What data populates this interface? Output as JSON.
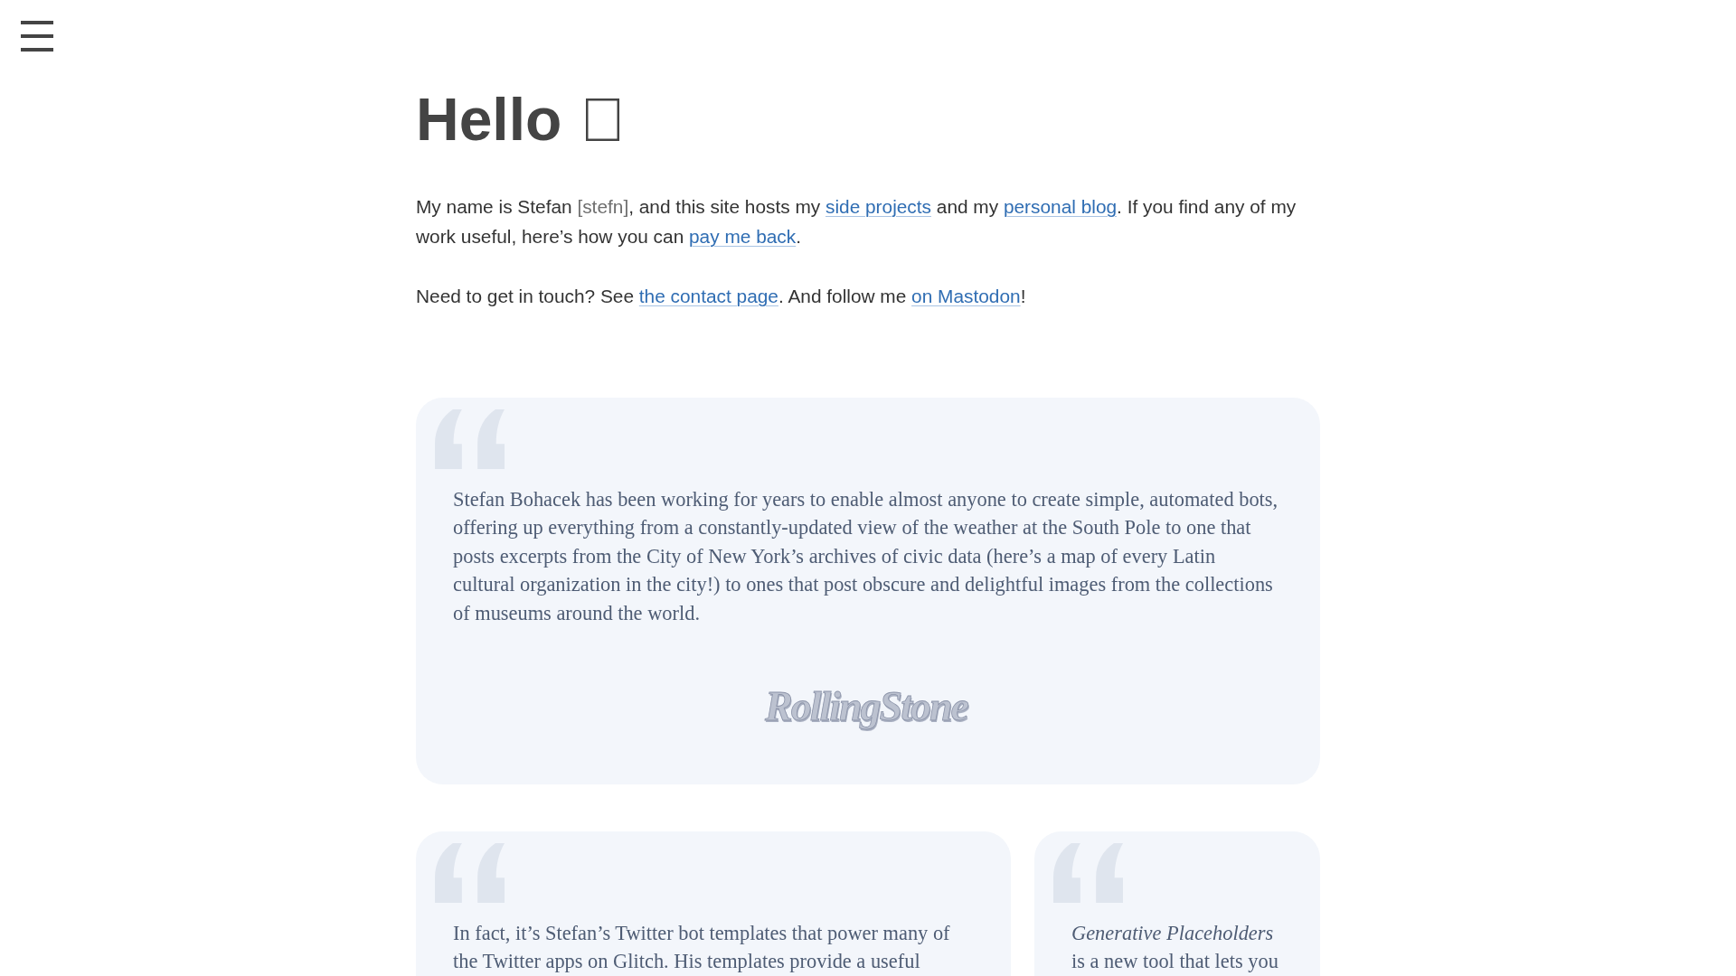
{
  "heading": {
    "text": "Hello"
  },
  "intro": [
    {
      "segments": [
        {
          "kind": "text",
          "text": "My name is Stefan "
        },
        {
          "kind": "pronunciation",
          "text": "[stefn]"
        },
        {
          "kind": "text",
          "text": ", and this site hosts my "
        },
        {
          "kind": "link",
          "text": "side projects"
        },
        {
          "kind": "text",
          "text": " and my "
        },
        {
          "kind": "link",
          "text": "personal blog"
        },
        {
          "kind": "text",
          "text": ". If you find any of my work useful, here’s how you can "
        },
        {
          "kind": "link",
          "text": "pay me back"
        },
        {
          "kind": "text",
          "text": "."
        }
      ]
    },
    {
      "segments": [
        {
          "kind": "text",
          "text": "Need to get in touch? See "
        },
        {
          "kind": "link",
          "text": "the contact page"
        },
        {
          "kind": "text",
          "text": ". And follow me "
        },
        {
          "kind": "link",
          "text": "on Mastodon"
        },
        {
          "kind": "text",
          "text": "!"
        }
      ]
    }
  ],
  "testimonial_rows": [
    {
      "items": [
        {
          "quote": "Stefan Bohacek has been working for years to enable almost anyone to create simple, automated bots, offering up everything from a constantly-updated view of the weather at the South Pole to one that posts excerpts from the City of New York’s archives of civic data (here’s a map of every Latin cultural organization in the city!) to ones that post obscure and delightful images from the collections of museums around the world.",
          "logo": "RollingStone"
        }
      ]
    },
    {
      "items": [
        {
          "quote": "In fact, it’s Stefan’s Twitter bot templates that power many of the Twitter apps on Glitch. His templates provide a useful"
        },
        {
          "quote": "*Generative Placeholders* is a new tool that lets you"
        }
      ]
    }
  ]
}
